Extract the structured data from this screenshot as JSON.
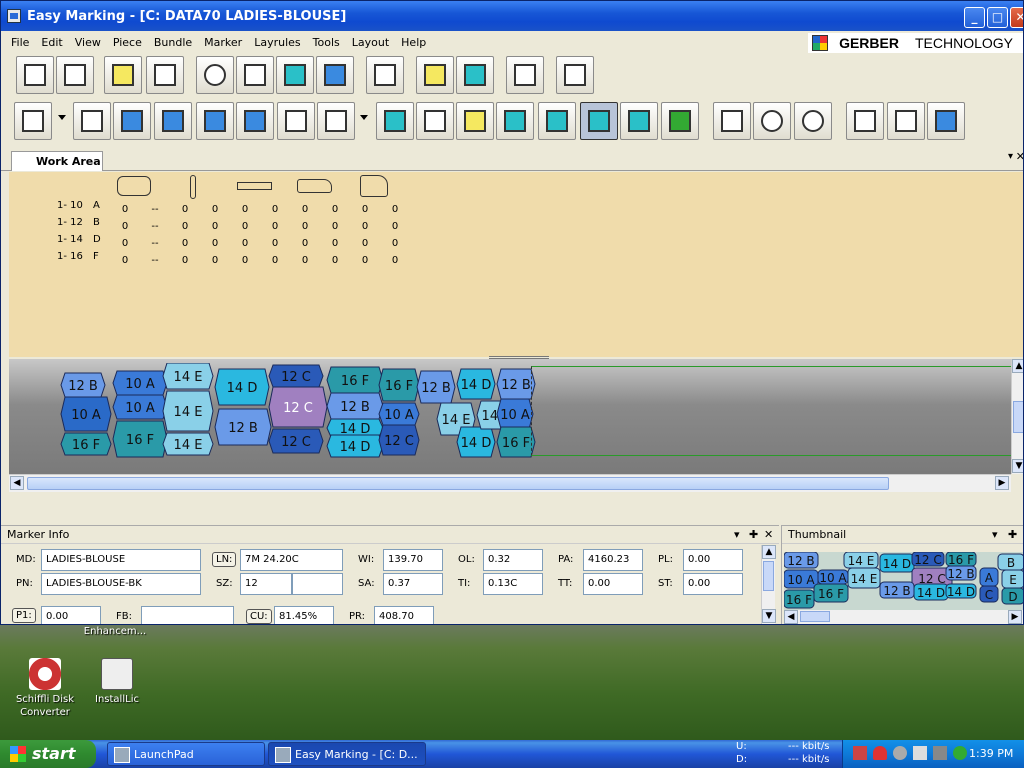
{
  "window": {
    "title": "Easy Marking - [C: DATA70 LADIES-BLOUSE]",
    "controls": [
      "_",
      "□",
      "✕"
    ]
  },
  "menu": [
    "File",
    "Edit",
    "View",
    "Piece",
    "Bundle",
    "Marker",
    "Layrules",
    "Tools",
    "Layout",
    "Help"
  ],
  "logo": {
    "brand": "GERBER",
    "suffix": "TECHNOLOGY"
  },
  "toolbar1": [
    "open-marker-icon",
    "open-folder-icon",
    "save-icon",
    "save-as-icon",
    "zoom-icon",
    "fit-window-icon",
    "zoom-in-icon",
    "zoom-region-icon",
    "select-icon",
    "add-piece-icon",
    "add-bundle-icon",
    "report-icon",
    "move-selection-icon"
  ],
  "toolbar2": [
    "flip-horizontal-icon",
    "group-icon",
    "butt-right-icon",
    "butt-left-icon",
    "slide-right-icon",
    "fold-icon",
    "rotate-icon",
    "rotate-45-icon",
    "piece-icon",
    "buffer-icon",
    "shrink-icon",
    "match-icon",
    "fit-icon",
    "overlap-icon",
    "bounds-icon",
    "grid-icon",
    "mirror-icon",
    "bulb-icon",
    "bulb-outline-icon",
    "single-view-icon",
    "dual-view-icon",
    "thumbnail-view-icon"
  ],
  "worktab": {
    "label": "Work Area"
  },
  "sizes": [
    {
      "label": "1- 10",
      "code": "A",
      "values": [
        "0",
        "--",
        "0",
        "0",
        "0",
        "0",
        "0",
        "0",
        "0",
        "0"
      ]
    },
    {
      "label": "1- 12",
      "code": "B",
      "values": [
        "0",
        "--",
        "0",
        "0",
        "0",
        "0",
        "0",
        "0",
        "0",
        "0"
      ]
    },
    {
      "label": "1- 14",
      "code": "D",
      "values": [
        "0",
        "--",
        "0",
        "0",
        "0",
        "0",
        "0",
        "0",
        "0",
        "0"
      ]
    },
    {
      "label": "1- 16",
      "code": "F",
      "values": [
        "0",
        "--",
        "0",
        "0",
        "0",
        "0",
        "0",
        "0",
        "0",
        "0"
      ]
    }
  ],
  "marker_pieces": [
    {
      "label": "12 B",
      "color": "#6a9ae8"
    },
    {
      "label": "10 A",
      "color": "#3a7ad8"
    },
    {
      "label": "10 A",
      "color": "#3a7ad8"
    },
    {
      "label": "10 A",
      "color": "#2a6ac8"
    },
    {
      "label": "16 F",
      "color": "#2a9aa8"
    },
    {
      "label": "16 F",
      "color": "#2a9aa8"
    },
    {
      "label": "14 E",
      "color": "#8ad0e8"
    },
    {
      "label": "14 E",
      "color": "#8ad0e8"
    },
    {
      "label": "14 E",
      "color": "#8ad0e8"
    },
    {
      "label": "14 D",
      "color": "#2ab8e0"
    },
    {
      "label": "12 B",
      "color": "#6a9ae8"
    },
    {
      "label": "12 C",
      "color": "#2a5ab8"
    },
    {
      "label": "12 C",
      "color": "#a080c0"
    },
    {
      "label": "12 C",
      "color": "#2a5ab8"
    },
    {
      "label": "16 F",
      "color": "#2a9aa8"
    },
    {
      "label": "12 B",
      "color": "#6a9ae8"
    },
    {
      "label": "14 D",
      "color": "#2ab8e0"
    },
    {
      "label": "14 D",
      "color": "#2ab8e0"
    },
    {
      "label": "16 F",
      "color": "#2a9aa8"
    },
    {
      "label": "10 A",
      "color": "#3a7ad8"
    },
    {
      "label": "12 C",
      "color": "#2a5ab8"
    },
    {
      "label": "12 B",
      "color": "#6a9ae8"
    },
    {
      "label": "14 E",
      "color": "#8ad0e8"
    },
    {
      "label": "14 D",
      "color": "#2ab8e0"
    },
    {
      "label": "14 D",
      "color": "#2ab8e0"
    },
    {
      "label": "14 E",
      "color": "#8ad0e8"
    },
    {
      "label": "12 C",
      "color": "#2a5ab8"
    },
    {
      "label": "12 B",
      "color": "#6a9ae8"
    },
    {
      "label": "10 A",
      "color": "#3a7ad8"
    },
    {
      "label": "16 F",
      "color": "#2a9aa8"
    }
  ],
  "marker_info": {
    "title": "Marker Info",
    "md": {
      "label": "MD:",
      "value": "LADIES-BLOUSE"
    },
    "pn": {
      "label": "PN:",
      "value": "LADIES-BLOUSE-BK"
    },
    "p1": {
      "label": "P1:",
      "value": "0.00"
    },
    "ln": {
      "label": "LN:",
      "value": "7M 24.20C"
    },
    "sz": {
      "label": "SZ:",
      "value": "12",
      "value2": ""
    },
    "fb": {
      "label": "FB:",
      "value": ""
    },
    "cu": {
      "label": "CU:",
      "value": "81.45%"
    },
    "wi": {
      "label": "WI:",
      "value": "139.70"
    },
    "sa": {
      "label": "SA:",
      "value": "0.37"
    },
    "pr": {
      "label": "PR:",
      "value": "408.70"
    },
    "ol": {
      "label": "OL:",
      "value": "0.32"
    },
    "ti": {
      "label": "TI:",
      "value": "0.13C"
    },
    "pa": {
      "label": "PA:",
      "value": "4160.23"
    },
    "tt": {
      "label": "TT:",
      "value": "0.00"
    },
    "pl": {
      "label": "PL:",
      "value": "0.00"
    },
    "st": {
      "label": "ST:",
      "value": "0.00"
    }
  },
  "thumbnail": {
    "title": "Thumbnail",
    "labels": [
      "12 B",
      "14 E",
      "14 D",
      "12 C",
      "16 F",
      "B",
      "10 A",
      "10 A",
      "14 E",
      "12 C",
      "12 B",
      "A",
      "E",
      "16 F",
      "12 B",
      "14 D",
      "C",
      "D",
      "16 F",
      "14 D"
    ]
  },
  "desktop": [
    {
      "label": "Enhancem...",
      "color": "#6a8"
    },
    {
      "label": "Schiffli Disk Converter",
      "color": "#c33"
    },
    {
      "label": "InstallLic",
      "color": "#eee"
    }
  ],
  "taskbar": {
    "start": "start",
    "tasks": [
      "LaunchPad",
      "Easy Marking - [C: D..."
    ],
    "net_u": "U:",
    "net_d": "D:",
    "net_u_val": "--- kbit/s",
    "net_d_val": "--- kbit/s",
    "time": "1:39 PM"
  }
}
